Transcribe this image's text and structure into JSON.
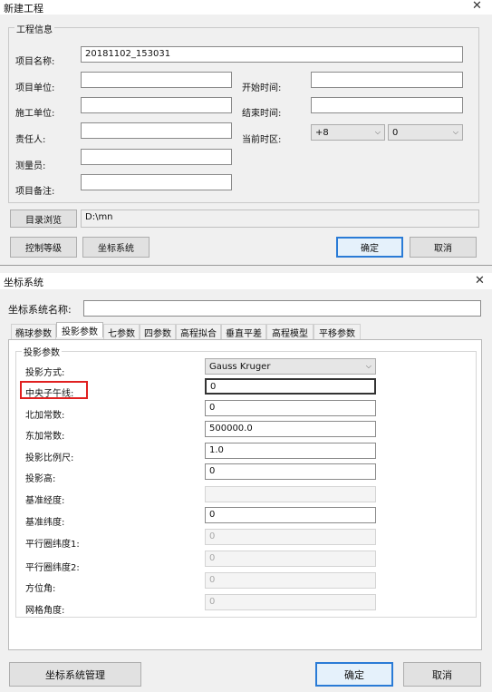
{
  "dialog1": {
    "title": "新建工程",
    "group_label": "工程信息",
    "project_name_label": "项目名称:",
    "project_name_value": "20181102_153031",
    "project_unit_label": "项目单位:",
    "construction_unit_label": "施工单位:",
    "responsible_label": "责任人:",
    "surveyor_label": "测量员:",
    "remark_label": "项目备注:",
    "start_time_label": "开始时间:",
    "end_time_label": "结束时间:",
    "timezone_label": "当前时区:",
    "timezone_value": "+8",
    "timezone_minutes": "0",
    "browse_button": "目录浏览",
    "browse_path": "D:\\mn",
    "control_level_button": "控制等级",
    "coord_system_button": "坐标系统",
    "ok_button": "确定",
    "cancel_button": "取消"
  },
  "dialog2": {
    "title": "坐标系统",
    "name_label": "坐标系统名称:",
    "name_value": "",
    "tabs": [
      "椭球参数",
      "投影参数",
      "七参数",
      "四参数",
      "高程拟合",
      "垂直平差",
      "高程模型",
      "平移参数"
    ],
    "active_tab": "投影参数",
    "group_label": "投影参数",
    "fields": {
      "projection_method_label": "投影方式:",
      "projection_method_value": "Gauss Kruger",
      "central_meridian_label": "中央子午线:",
      "central_meridian_value": "0",
      "false_northing_label": "北加常数:",
      "false_northing_value": "0",
      "false_easting_label": "东加常数:",
      "false_easting_value": "500000.0",
      "scale_label": "投影比例尺:",
      "scale_value": "1.0",
      "height_label": "投影高:",
      "height_value": "0",
      "base_longitude_label": "基准经度:",
      "base_longitude_value": "",
      "base_latitude_label": "基准纬度:",
      "base_latitude_value": "0",
      "parallel1_label": "平行圈纬度1:",
      "parallel1_value": "0",
      "parallel2_label": "平行圈纬度2:",
      "parallel2_value": "0",
      "azimuth_label": "方位角:",
      "azimuth_value": "0",
      "grid_angle_label": "网格角度:",
      "grid_angle_value": "0"
    },
    "manage_button": "坐标系统管理",
    "ok_button": "确定",
    "cancel_button": "取消"
  },
  "colors": {
    "highlight": "#e02020",
    "focus": "#2a7bd6"
  }
}
